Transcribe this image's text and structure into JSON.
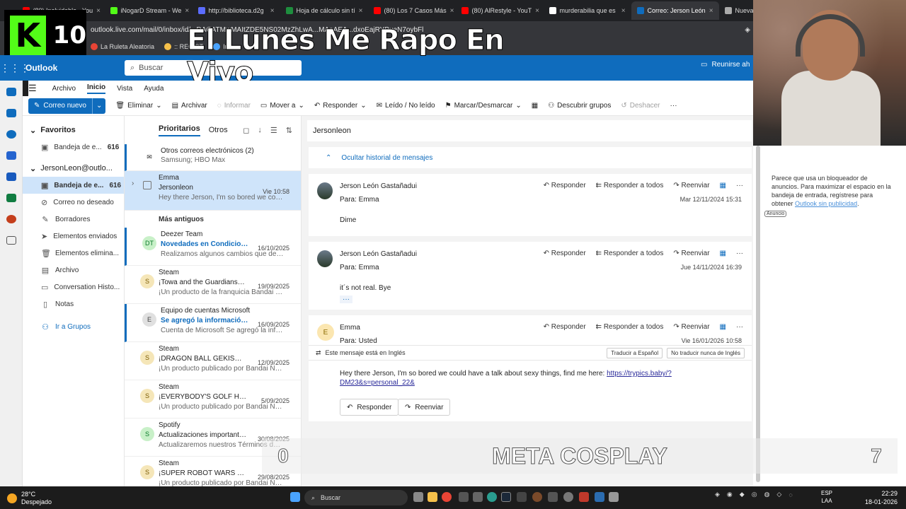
{
  "browser": {
    "tabs": [
      {
        "label": "(80) Inolvidable - You",
        "color": "#ff0000"
      },
      {
        "label": "iNogarD Stream - We",
        "color": "#53fc18"
      },
      {
        "label": "http://biblioteca.d2g",
        "color": "#5b6cff"
      },
      {
        "label": "Hoja de cálculo sin tí",
        "color": "#1e8e3e"
      },
      {
        "label": "(80) Los 7 Casos Más",
        "color": "#ff0000"
      },
      {
        "label": "(80) AlRestyle - YouT",
        "color": "#ff0000"
      },
      {
        "label": "murderabilia que es",
        "color": "#ffffff"
      },
      {
        "label": "Correo: Jerson León",
        "color": "#0f6cbd"
      },
      {
        "label": "Nueva pe",
        "color": "#aaaaaa"
      }
    ],
    "address": "outlook.live.com/mail/0/inbox/id/...DACATMwMAItZDE5NS02MzZhLwA...MAoAEA...dxoEajRYBueN7oybFl",
    "bookmarks": [
      "La Ruleta Aleatoria",
      ":: REGIST",
      "Inbo"
    ]
  },
  "stream": {
    "badge_letter": "K",
    "badge_number": "10",
    "title": "El Lunes Me Rapo En Vivo",
    "meta_left": "0",
    "meta_center": "META COSPLAY",
    "meta_right": "7"
  },
  "outlook": {
    "app_name": "Outlook",
    "search_placeholder": "Buscar",
    "meet_label": "Reunirse ah",
    "menu_tabs": [
      "Archivo",
      "Inicio",
      "Vista",
      "Ayuda"
    ],
    "ribbon": {
      "new_mail": "Correo nuevo",
      "delete": "Eliminar",
      "archive": "Archivar",
      "report": "Informar",
      "move": "Mover a",
      "reply": "Responder",
      "read_unread": "Leído / No leído",
      "flag": "Marcar/Desmarcar",
      "discover": "Descubrir grupos",
      "undo": "Deshacer"
    },
    "folders": {
      "favorites_label": "Favoritos",
      "fav_inbox": "Bandeja de e...",
      "fav_inbox_count": "616",
      "account": "JersonLeon@outlo...",
      "items": [
        {
          "label": "Bandeja de e...",
          "count": "616",
          "icon": "inbox-icon"
        },
        {
          "label": "Correo no deseado",
          "count": "",
          "icon": "junk-icon"
        },
        {
          "label": "Borradores",
          "count": "",
          "icon": "drafts-icon"
        },
        {
          "label": "Elementos enviados",
          "count": "",
          "icon": "sent-icon"
        },
        {
          "label": "Elementos elimina...",
          "count": "",
          "icon": "trash-icon"
        },
        {
          "label": "Archivo",
          "count": "",
          "icon": "archive-icon"
        },
        {
          "label": "Conversation Histo...",
          "count": "",
          "icon": "folder-icon"
        },
        {
          "label": "Notas",
          "count": "",
          "icon": "notes-icon"
        }
      ],
      "groups_link": "Ir a Grupos"
    },
    "list": {
      "tab_focused": "Prioritarios",
      "tab_other": "Otros",
      "other_mail": {
        "title": "Otros correos electrónicos (2)",
        "preview": "Samsung; HBO Max"
      },
      "selected": {
        "sender": "Emma",
        "subject": "Jersonleon",
        "date": "Vie 10:58",
        "preview": "Hey there Jerson, I'm so bored we could ..."
      },
      "older_label": "Más antiguos",
      "items": [
        {
          "initials": "DT",
          "sender": "Deezer Team",
          "subject": "Novedades en Condiciones...",
          "date": "16/10/2025",
          "preview": "Realizamos algunos cambios que debes ...",
          "av_color": "#c8f0c8",
          "av_text": "#0a7a2a",
          "unread": true
        },
        {
          "initials": "S",
          "sender": "Steam",
          "subject": "¡Towa and the Guardians of ...",
          "date": "19/09/2025",
          "preview": "¡Un producto de la franquicia Bandai Na...",
          "av_color": "#f5e6b8",
          "av_text": "#7a5a00",
          "unread": false
        },
        {
          "initials": "E",
          "sender": "Equipo de cuentas Microsoft",
          "subject": "Se agregó la información d...",
          "date": "16/09/2025",
          "preview": "Cuenta de Microsoft Se agregó la inform...",
          "av_color": "#e0e0e0",
          "av_text": "#444444",
          "unread": true
        },
        {
          "initials": "S",
          "sender": "Steam",
          "subject": "¡DRAGON BALL GEKISHIN S...",
          "date": "12/09/2025",
          "preview": "¡Un producto publicado por Bandai Nam...",
          "av_color": "#f5e6b8",
          "av_text": "#7a5a00",
          "unread": false
        },
        {
          "initials": "S",
          "sender": "Steam",
          "subject": "¡EVERYBODY'S GOLF HOT SH...",
          "date": "5/09/2025",
          "preview": "¡Un producto publicado por Bandai Nam...",
          "av_color": "#f5e6b8",
          "av_text": "#7a5a00",
          "unread": false
        },
        {
          "initials": "S",
          "sender": "Spotify",
          "subject": "Actualizaciones importantes...",
          "date": "30/08/2025",
          "preview": "Actualizaremos nuestros Términos de Us...",
          "av_color": "#c8f0c8",
          "av_text": "#0a7a2a",
          "unread": false
        },
        {
          "initials": "S",
          "sender": "Steam",
          "subject": "¡SUPER ROBOT WARS Y ya e...",
          "date": "29/08/2025",
          "preview": "¡Un producto publicado por Bandai Nam...",
          "av_color": "#f5e6b8",
          "av_text": "#7a5a00",
          "unread": false
        }
      ]
    },
    "reading": {
      "conversation_title": "Jersonleon",
      "hide_history": "Ocultar historial de mensajes",
      "reply": "Responder",
      "reply_all": "Responder a todos",
      "forward": "Reenviar",
      "messages": [
        {
          "from": "Jerson León Gastañadui",
          "to": "Para:  Emma",
          "date": "Mar 12/11/2024 15:31",
          "body": "Dime"
        },
        {
          "from": "Jerson León Gastañadui",
          "to": "Para:  Emma",
          "date": "Jue 14/11/2024 16:39",
          "body": "it´s not real. Bye"
        },
        {
          "from": "Emma",
          "to": "Para:  Usted",
          "date": "Vie 16/01/2026 10:58",
          "initial": "E",
          "translate_notice": "Este mensaje está en Inglés",
          "translate_btn": "Traducir a Español",
          "no_translate_btn": "No traducir nunca de Inglés",
          "body": "Hey there Jerson, I'm so bored we could have a talk about sexy things, find me here: ",
          "link": "https://trypics.baby/?DM23&s=personal_22&",
          "link_line1": "https://trypics.baby/?",
          "link_line2": "DM23&s=personal_22&"
        }
      ],
      "ellipsis": "···"
    },
    "ad": {
      "text": "Parece que usa un bloqueador de anuncios. Para maximizar el espacio en la bandeja de entrada, regístrese para obtener ",
      "link": "Outlook sin publicidad",
      "period": ".",
      "tag": "Anuncio"
    }
  },
  "taskbar": {
    "temp": "28°C",
    "weather": "Despejado",
    "search": "Buscar",
    "lang1": "ESP",
    "lang2": "LAA",
    "time": "22:29",
    "date": "18-01-2026"
  }
}
